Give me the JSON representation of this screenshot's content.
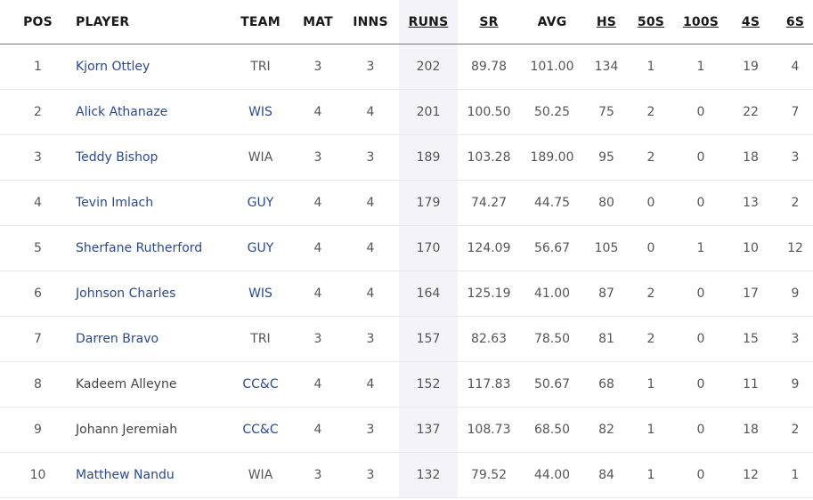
{
  "headers": {
    "pos": "POS",
    "player": "PLAYER",
    "team": "TEAM",
    "mat": "MAT",
    "inns": "INNS",
    "runs": "RUNS",
    "sr": "SR",
    "avg": "AVG",
    "hs": "HS",
    "fifties": "50S",
    "hundreds": "100S",
    "fours": "4S",
    "sixes": "6S"
  },
  "sorted_column": "RUNS",
  "link_color": "#2b4a8b",
  "rows": [
    {
      "pos": "1",
      "player": "Kjorn Ottley",
      "player_link": true,
      "team": "TRI",
      "team_link": false,
      "mat": "3",
      "inns": "3",
      "runs": "202",
      "sr": "89.78",
      "avg": "101.00",
      "hs": "134",
      "fifties": "1",
      "hundreds": "1",
      "fours": "19",
      "sixes": "4"
    },
    {
      "pos": "2",
      "player": "Alick Athanaze",
      "player_link": true,
      "team": "WIS",
      "team_link": true,
      "mat": "4",
      "inns": "4",
      "runs": "201",
      "sr": "100.50",
      "avg": "50.25",
      "hs": "75",
      "fifties": "2",
      "hundreds": "0",
      "fours": "22",
      "sixes": "7"
    },
    {
      "pos": "3",
      "player": "Teddy Bishop",
      "player_link": true,
      "team": "WIA",
      "team_link": false,
      "mat": "3",
      "inns": "3",
      "runs": "189",
      "sr": "103.28",
      "avg": "189.00",
      "hs": "95",
      "fifties": "2",
      "hundreds": "0",
      "fours": "18",
      "sixes": "3"
    },
    {
      "pos": "4",
      "player": "Tevin Imlach",
      "player_link": true,
      "team": "GUY",
      "team_link": true,
      "mat": "4",
      "inns": "4",
      "runs": "179",
      "sr": "74.27",
      "avg": "44.75",
      "hs": "80",
      "fifties": "0",
      "hundreds": "0",
      "fours": "13",
      "sixes": "2"
    },
    {
      "pos": "5",
      "player": "Sherfane Rutherford",
      "player_link": true,
      "team": "GUY",
      "team_link": true,
      "mat": "4",
      "inns": "4",
      "runs": "170",
      "sr": "124.09",
      "avg": "56.67",
      "hs": "105",
      "fifties": "0",
      "hundreds": "1",
      "fours": "10",
      "sixes": "12"
    },
    {
      "pos": "6",
      "player": "Johnson Charles",
      "player_link": true,
      "team": "WIS",
      "team_link": true,
      "mat": "4",
      "inns": "4",
      "runs": "164",
      "sr": "125.19",
      "avg": "41.00",
      "hs": "87",
      "fifties": "2",
      "hundreds": "0",
      "fours": "17",
      "sixes": "9"
    },
    {
      "pos": "7",
      "player": "Darren Bravo",
      "player_link": true,
      "team": "TRI",
      "team_link": false,
      "mat": "3",
      "inns": "3",
      "runs": "157",
      "sr": "82.63",
      "avg": "78.50",
      "hs": "81",
      "fifties": "2",
      "hundreds": "0",
      "fours": "15",
      "sixes": "3"
    },
    {
      "pos": "8",
      "player": "Kadeem Alleyne",
      "player_link": false,
      "team": "CC&C",
      "team_link": true,
      "mat": "4",
      "inns": "4",
      "runs": "152",
      "sr": "117.83",
      "avg": "50.67",
      "hs": "68",
      "fifties": "1",
      "hundreds": "0",
      "fours": "11",
      "sixes": "9"
    },
    {
      "pos": "9",
      "player": "Johann Jeremiah",
      "player_link": false,
      "team": "CC&C",
      "team_link": true,
      "mat": "4",
      "inns": "3",
      "runs": "137",
      "sr": "108.73",
      "avg": "68.50",
      "hs": "82",
      "fifties": "1",
      "hundreds": "0",
      "fours": "18",
      "sixes": "2"
    },
    {
      "pos": "10",
      "player": "Matthew Nandu",
      "player_link": true,
      "team": "WIA",
      "team_link": false,
      "mat": "3",
      "inns": "3",
      "runs": "132",
      "sr": "79.52",
      "avg": "44.00",
      "hs": "84",
      "fifties": "1",
      "hundreds": "0",
      "fours": "12",
      "sixes": "1"
    }
  ]
}
